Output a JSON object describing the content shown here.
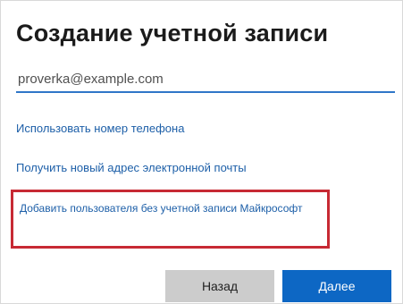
{
  "dialog": {
    "title": "Создание учетной записи"
  },
  "email": {
    "value": "proverka@example.com"
  },
  "links": {
    "use_phone": "Использовать номер телефона",
    "new_email": "Получить новый адрес электронной почты",
    "add_without_ms": "Добавить пользователя без учетной записи Майкрософт"
  },
  "buttons": {
    "back": "Назад",
    "next": "Далее"
  },
  "colors": {
    "accent": "#0d67c4",
    "link": "#1d5fa8",
    "highlight": "#c72a34"
  }
}
